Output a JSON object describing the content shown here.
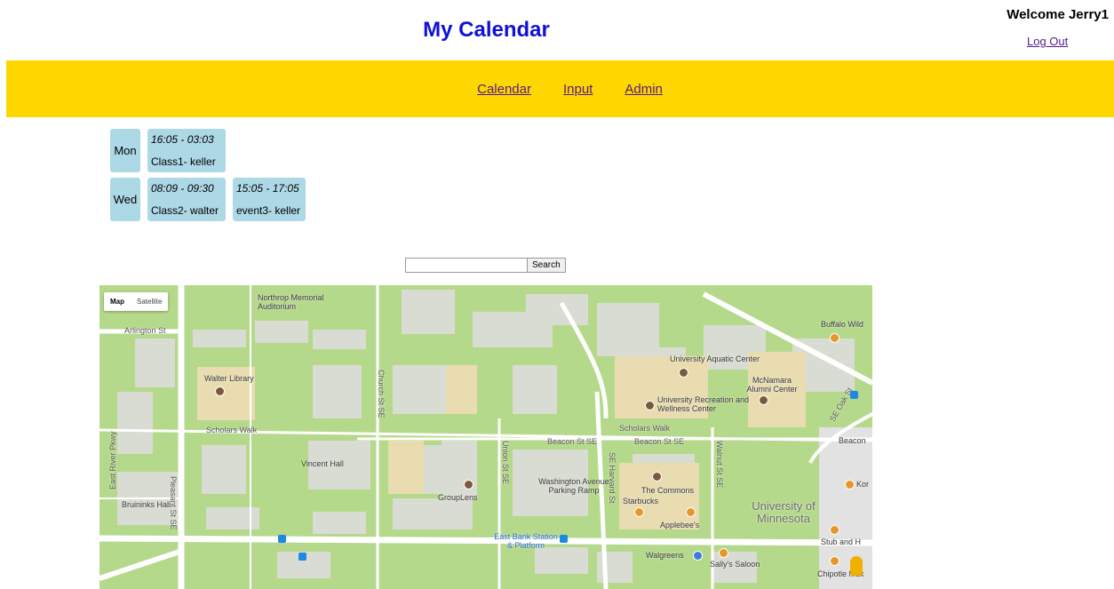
{
  "header": {
    "title": "My Calendar",
    "welcome": "Welcome Jerry1",
    "logout": "Log Out"
  },
  "nav": {
    "items": [
      {
        "label": "Calendar"
      },
      {
        "label": "Input"
      },
      {
        "label": "Admin"
      }
    ]
  },
  "schedule": {
    "days": [
      {
        "day": "Mon",
        "events": [
          {
            "time": "16:05 - 03:03",
            "title": "Class1- keller"
          }
        ]
      },
      {
        "day": "Wed",
        "events": [
          {
            "time": "08:09 - 09:30",
            "title": "Class2- walter"
          },
          {
            "time": "15:05 - 17:05",
            "title": "event3- keller"
          }
        ]
      }
    ]
  },
  "search": {
    "value": "",
    "button": "Search"
  },
  "map": {
    "type_control": {
      "map": "Map",
      "satellite": "Satellite"
    },
    "labels": {
      "northrop": "Northrop Memorial Auditorium",
      "arlington": "Arlington St",
      "walter_library": "Walter Library",
      "scholars_walk_1": "Scholars Walk",
      "scholars_walk_2": "Scholars Walk",
      "vincent_hall": "Vincent Hall",
      "grouplens": "GroupLens",
      "bruininks": "Bruininks Hall",
      "east_river": "East River Pkwy",
      "pleasant_st": "Pleasant St SE",
      "church_st": "Church St SE",
      "union_st": "Union St SE",
      "se_harvard": "SE Harvard St",
      "beacon_1": "Beacon St SE",
      "beacon_2": "Beacon St SE",
      "washington_ramp": "Washington Avenue Parking Ramp",
      "east_bank": "East Bank Station & Platform",
      "aquatic": "University Aquatic Center",
      "mcnamara": "McNamara Alumni Center",
      "rec_center": "University Recreation and Wellness Center",
      "commons": "The Commons",
      "starbucks": "Starbucks",
      "applebees": "Applebee's",
      "walgreens": "Walgreens",
      "sallys": "Sally's Saloon",
      "umn": "University of Minnesota",
      "buffalo": "Buffalo Wild",
      "stub": "Stub and H",
      "chipotle": "Chipotle Mex",
      "kor": "Kor",
      "beacon_right": "Beacon",
      "walnut": "Walnut St SE",
      "se_oak": "SE Oak St"
    }
  }
}
